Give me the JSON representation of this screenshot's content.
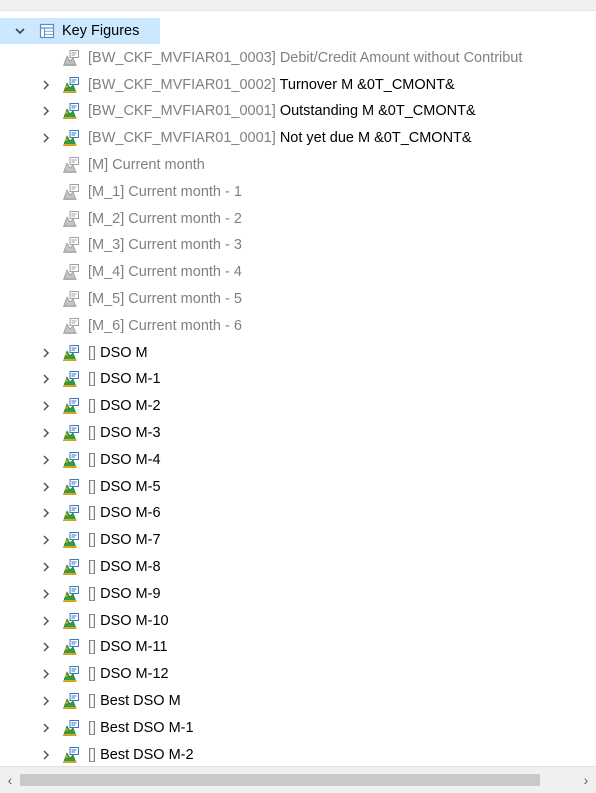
{
  "header_item": {
    "label": "Key Figures"
  },
  "rows": [
    {
      "tech": "[BW_CKF_MVFIAR01_0003]",
      "desc": "Debit/Credit Amount without Contribut",
      "expandable": false,
      "icon": "structure-gray",
      "desc_gray": true
    },
    {
      "tech": "[BW_CKF_MVFIAR01_0002]",
      "desc": "Turnover M &0T_CMONT&",
      "expandable": true,
      "icon": "formula-color",
      "desc_gray": false
    },
    {
      "tech": "[BW_CKF_MVFIAR01_0001]",
      "desc": "Outstanding M &0T_CMONT&",
      "expandable": true,
      "icon": "formula-color",
      "desc_gray": false
    },
    {
      "tech": "[BW_CKF_MVFIAR01_0001]",
      "desc": "Not yet due M &0T_CMONT&",
      "expandable": true,
      "icon": "formula-color",
      "desc_gray": false
    },
    {
      "tech": "[M]",
      "desc": "Current month",
      "expandable": false,
      "icon": "formula-gray",
      "desc_gray": true
    },
    {
      "tech": "[M_1]",
      "desc": "Current month - 1",
      "expandable": false,
      "icon": "formula-gray",
      "desc_gray": true
    },
    {
      "tech": "[M_2]",
      "desc": "Current month - 2",
      "expandable": false,
      "icon": "formula-gray",
      "desc_gray": true
    },
    {
      "tech": "[M_3]",
      "desc": "Current month - 3",
      "expandable": false,
      "icon": "formula-gray",
      "desc_gray": true
    },
    {
      "tech": "[M_4]",
      "desc": "Current month - 4",
      "expandable": false,
      "icon": "formula-gray",
      "desc_gray": true
    },
    {
      "tech": "[M_5]",
      "desc": "Current month - 5",
      "expandable": false,
      "icon": "formula-gray",
      "desc_gray": true
    },
    {
      "tech": "[M_6]",
      "desc": "Current month - 6",
      "expandable": false,
      "icon": "formula-gray",
      "desc_gray": true
    },
    {
      "tech": "[]",
      "desc": "DSO M",
      "expandable": true,
      "icon": "formula-color",
      "desc_gray": false
    },
    {
      "tech": "[]",
      "desc": "DSO M-1",
      "expandable": true,
      "icon": "formula-color",
      "desc_gray": false
    },
    {
      "tech": "[]",
      "desc": "DSO M-2",
      "expandable": true,
      "icon": "formula-color",
      "desc_gray": false
    },
    {
      "tech": "[]",
      "desc": "DSO M-3",
      "expandable": true,
      "icon": "formula-color",
      "desc_gray": false
    },
    {
      "tech": "[]",
      "desc": "DSO M-4",
      "expandable": true,
      "icon": "formula-color",
      "desc_gray": false
    },
    {
      "tech": "[]",
      "desc": "DSO M-5",
      "expandable": true,
      "icon": "formula-color",
      "desc_gray": false
    },
    {
      "tech": "[]",
      "desc": "DSO M-6",
      "expandable": true,
      "icon": "formula-color",
      "desc_gray": false
    },
    {
      "tech": "[]",
      "desc": "DSO M-7",
      "expandable": true,
      "icon": "formula-color",
      "desc_gray": false
    },
    {
      "tech": "[]",
      "desc": "DSO M-8",
      "expandable": true,
      "icon": "formula-color",
      "desc_gray": false
    },
    {
      "tech": "[]",
      "desc": "DSO M-9",
      "expandable": true,
      "icon": "formula-color",
      "desc_gray": false
    },
    {
      "tech": "[]",
      "desc": "DSO M-10",
      "expandable": true,
      "icon": "formula-color",
      "desc_gray": false
    },
    {
      "tech": "[]",
      "desc": "DSO M-11",
      "expandable": true,
      "icon": "formula-color",
      "desc_gray": false
    },
    {
      "tech": "[]",
      "desc": "DSO M-12",
      "expandable": true,
      "icon": "formula-color",
      "desc_gray": false
    },
    {
      "tech": "[]",
      "desc": "Best DSO M",
      "expandable": true,
      "icon": "formula-color",
      "desc_gray": false
    },
    {
      "tech": "[]",
      "desc": "Best DSO M-1",
      "expandable": true,
      "icon": "formula-color",
      "desc_gray": false
    },
    {
      "tech": "[]",
      "desc": "Best DSO M-2",
      "expandable": true,
      "icon": "formula-color",
      "desc_gray": false
    }
  ],
  "colors": {
    "selection": "#cce8ff",
    "tech_text": "#808080",
    "gray_text": "#808080"
  },
  "icons": {
    "header": "table-icon",
    "chevron_expanded": "chevron-down-icon",
    "chevron_collapsed": "chevron-right-icon",
    "scroll_left": "arrow-left-icon",
    "scroll_right": "arrow-right-icon"
  }
}
